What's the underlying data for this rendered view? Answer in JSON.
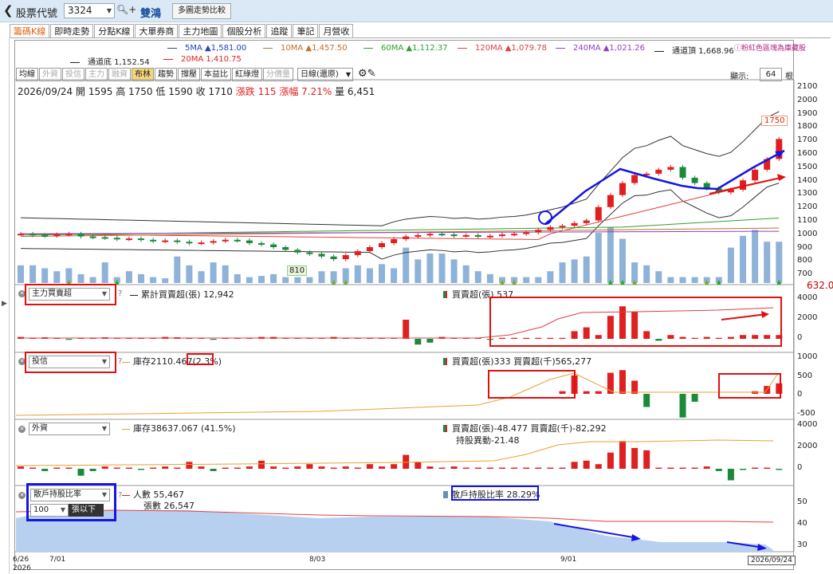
{
  "topbar": {
    "back_icon": "chevron-left-icon",
    "label": "股票代號",
    "stock_code": "3324",
    "stock_name": "雙鴻",
    "compare_button": "多圖走勢比較"
  },
  "tabs": [
    "籌碼K線",
    "即時走勢",
    "分點K線",
    "大單券商",
    "主力地圖",
    "個股分析",
    "追蹤",
    "筆記",
    "月營收"
  ],
  "ma_legend": [
    {
      "label": "5MA ▲1,581.00",
      "color": "#2040c0"
    },
    {
      "label": "10MA ▲1,457.50",
      "color": "#c07030"
    },
    {
      "label": "60MA ▲1,112.37",
      "color": "#30a030"
    },
    {
      "label": "120MA ▲1,079.78",
      "color": "#e04040"
    },
    {
      "label": "240MA ▲1,021.26",
      "color": "#9040c0"
    },
    {
      "label": "通道頂 1,668.96",
      "color": "#222222"
    },
    {
      "label": "通道底 1,152.54",
      "color": "#222222"
    },
    {
      "label": "20MA 1,410.75",
      "color": "#e02020"
    }
  ],
  "notice": "ⓘ粉紅色區塊為庫藏股",
  "toolbar": {
    "buttons": [
      "均線",
      "外資",
      "投信",
      "主力",
      "融資",
      "布林",
      "趨勢",
      "撐壓",
      "本益比",
      "紅綠燈",
      "分價量"
    ],
    "dim": [
      false,
      true,
      true,
      true,
      true,
      false,
      false,
      false,
      false,
      false,
      true
    ],
    "active": "布林",
    "period": "日線(還原)",
    "display_label": "顯示:",
    "display_count": "64",
    "display_unit": "根"
  },
  "ohlc": {
    "date": "2026/09/24",
    "open": "開 1595",
    "high": "高 1750",
    "low": "低 1590",
    "close": "收 1710",
    "change": "漲跌 115",
    "pct": "漲幅 7.21%",
    "volume": "量 6,451"
  },
  "price_axis": [
    "2100",
    "2000",
    "1900",
    "1800",
    "1700",
    "1600",
    "1500",
    "1400",
    "1300",
    "1200",
    "1100",
    "1000",
    "900",
    "800",
    "700"
  ],
  "price_callouts": {
    "high": "1750",
    "low": "810",
    "volume_max": "632.03"
  },
  "panel1": {
    "selector": "主力買賣超",
    "legend_line": "累計買賣超(張) 12,942",
    "legend_bar": "買賣超(張) 537",
    "axis": [
      "4000",
      "2000",
      "0"
    ]
  },
  "panel2": {
    "selector": "投信",
    "legend_line": "庫存2110.467",
    "legend_pct": "(2.3%)",
    "legend_bar": "買賣超(張)333 買賣超(千)565,277",
    "axis": [
      "1000",
      "500",
      "0",
      "-500"
    ]
  },
  "panel3": {
    "selector": "外資",
    "legend_line": "庫存38637.067 (41.5%)",
    "legend_bar": "買賣超(張)-48.477 買賣超(千)-82,292",
    "legend_bar2": "持股異動-21.48",
    "axis": [
      "4000",
      "2000",
      "0"
    ]
  },
  "panel4": {
    "selector": "散戶持股比率",
    "threshold": "100",
    "threshold_unit": "張以下",
    "legend_line": "人數 55,467",
    "legend_line2": "張數 26,547",
    "legend_bar": "散戶持股比率 28.29%",
    "axis": [
      "50",
      "40",
      "30"
    ]
  },
  "x_axis": [
    {
      "label": "6/26"
    },
    {
      "label": "2026"
    },
    {
      "label": "7/01"
    },
    {
      "label": "8/03"
    },
    {
      "label": "9/01"
    },
    {
      "label": "2026/09/24"
    }
  ],
  "colors": {
    "up": "#e02020",
    "down": "#1a8a3a",
    "volume": "#8fb2d8",
    "annotation_red": "#e0100f",
    "annotation_blue": "#1515e0"
  }
}
